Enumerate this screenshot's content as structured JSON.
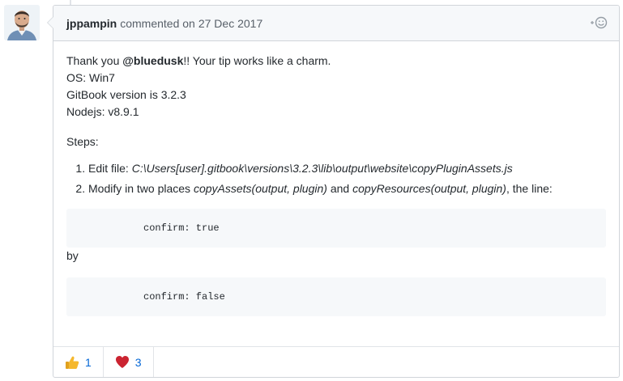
{
  "header": {
    "author": "jppampin",
    "verb": "commented on",
    "date": "27 Dec 2017",
    "reaction_add_icon": "plus-smiley-icon"
  },
  "body": {
    "thanks_prefix": "Thank you ",
    "mention": "@bluedusk",
    "thanks_suffix": "!! Your tip works like a charm.",
    "os": "OS: Win7",
    "gitbook": "GitBook version is 3.2.3",
    "nodejs": "Nodejs: v8.9.1",
    "steps_label": "Steps:",
    "step1_prefix": "Edit file: ",
    "step1_path": "C:\\Users[user].gitbook\\versions\\3.2.3\\lib\\output\\website\\copyPluginAssets.js",
    "step2_prefix": "Modify in two places ",
    "step2_fn1": "copyAssets(output, plugin)",
    "step2_and": " and ",
    "step2_fn2": "copyResources(output, plugin)",
    "step2_suffix": ", the line:",
    "code1": "confirm: true",
    "by": "by",
    "code2": "confirm: false"
  },
  "reactions": [
    {
      "icon": "thumbs-up-icon",
      "count": "1"
    },
    {
      "icon": "heart-icon",
      "count": "3"
    }
  ],
  "colors": {
    "link": "#0366d6",
    "border": "#d1d5da",
    "header_bg": "#f6f8fa",
    "code_bg": "#f6f8fa"
  }
}
